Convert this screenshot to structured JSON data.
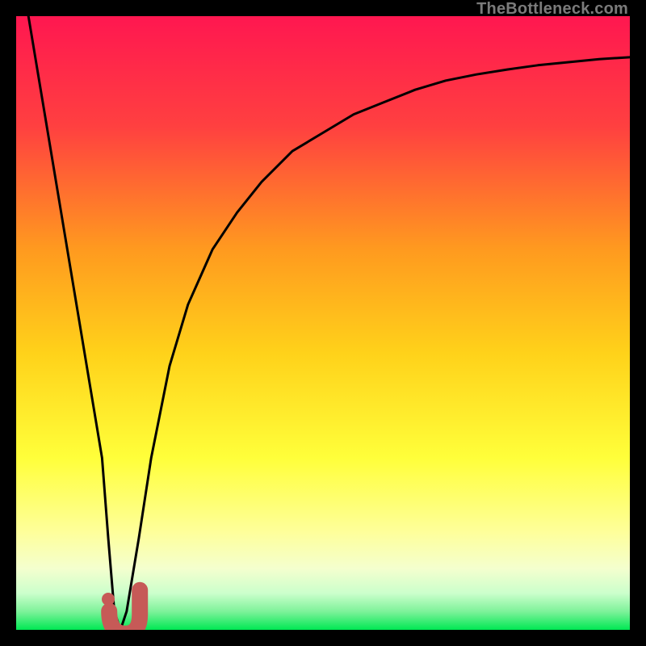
{
  "watermark": "TheBottleneck.com",
  "colors": {
    "gradient_top": "#ff1750",
    "gradient_mid1": "#ff7a2a",
    "gradient_mid2": "#ffd21a",
    "gradient_mid3": "#ffff40",
    "gradient_mid4": "#f6ffb0",
    "gradient_mid5": "#dcffd0",
    "gradient_bottom": "#00e853",
    "curve": "#000000",
    "marker": "#c65a57"
  },
  "chart_data": {
    "type": "line",
    "title": "",
    "xlabel": "",
    "ylabel": "",
    "xlim": [
      0,
      100
    ],
    "ylim": [
      0,
      100
    ],
    "series": [
      {
        "name": "bottleneck-curve",
        "x": [
          2,
          4,
          6,
          8,
          10,
          12,
          14,
          15,
          16,
          17,
          18,
          20,
          22,
          25,
          28,
          32,
          36,
          40,
          45,
          50,
          55,
          60,
          65,
          70,
          75,
          80,
          85,
          90,
          95,
          100
        ],
        "y": [
          100,
          88,
          76,
          64,
          52,
          40,
          28,
          15,
          3,
          0,
          3,
          15,
          28,
          43,
          53,
          62,
          68,
          73,
          78,
          81,
          84,
          86,
          88,
          89.5,
          90.5,
          91.3,
          92,
          92.5,
          93,
          93.3
        ]
      }
    ],
    "markers": [
      {
        "name": "J-marker",
        "x": 17,
        "y": 2,
        "shape": "J",
        "color": "#c65a57"
      },
      {
        "name": "dot-marker",
        "x": 15,
        "y": 5,
        "shape": "dot",
        "color": "#c65a57"
      }
    ]
  }
}
